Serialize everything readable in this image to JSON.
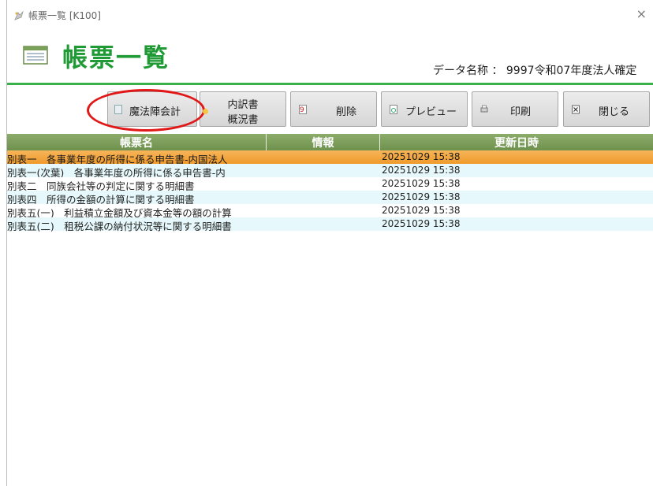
{
  "window": {
    "title": "帳票一覧 [K100]",
    "close_label": "×"
  },
  "header": {
    "title": "帳票一覧",
    "data_name_label": "データ名称 ： 9997令和07年度法人確定"
  },
  "toolbar": {
    "mahou_label": "魔法陣会計",
    "uchiwake_line1": "内訳書",
    "uchiwake_line2": "概況書",
    "delete_label": "削除",
    "preview_label": "プレビュー",
    "print_label": "印刷",
    "close_label": "閉じる"
  },
  "table": {
    "columns": [
      "帳票名",
      "情報",
      "更新日時"
    ],
    "rows": [
      {
        "name": "別表一　各事業年度の所得に係る申告書-内国法人",
        "info": "",
        "updated": "20251029 15:38",
        "selected": true
      },
      {
        "name": "別表一(次葉)　各事業年度の所得に係る申告書-内",
        "info": "",
        "updated": "20251029 15:38"
      },
      {
        "name": "別表二　同族会社等の判定に関する明細書",
        "info": "",
        "updated": "20251029 15:38"
      },
      {
        "name": "別表四　所得の金額の計算に関する明細書",
        "info": "",
        "updated": "20251029 15:38"
      },
      {
        "name": "別表五(一)　利益積立金額及び資本金等の額の計算",
        "info": "",
        "updated": "20251029 15:38"
      },
      {
        "name": "別表五(二)　租税公課の納付状況等に関する明細書",
        "info": "",
        "updated": "20251029 15:38"
      }
    ]
  },
  "colors": {
    "accent_green": "#1f9a35",
    "header_row": "#7d9e5c",
    "selected_row": "#f2a43c",
    "alt_row": "#e6f8fb",
    "highlight_ellipse": "#e01818"
  },
  "icons": [
    "app-icon",
    "list-icon",
    "document-icon",
    "delete-icon",
    "preview-icon",
    "print-icon",
    "close-icon"
  ]
}
